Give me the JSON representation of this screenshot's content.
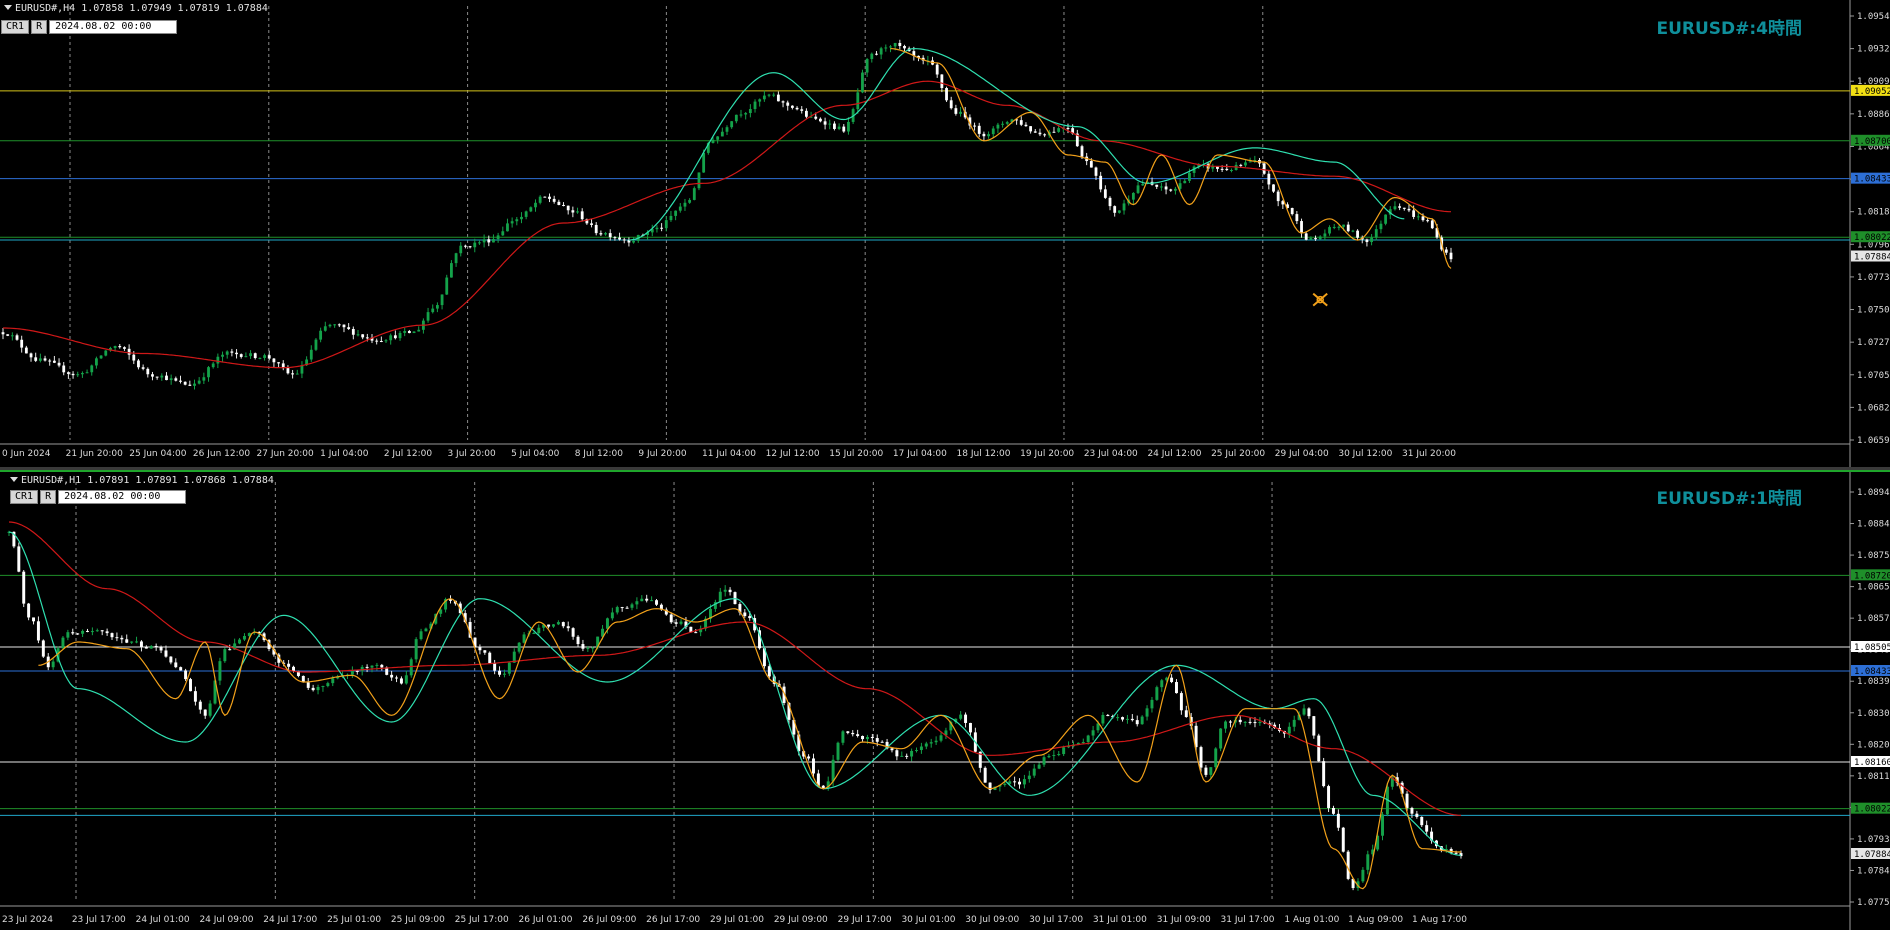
{
  "panes": [
    {
      "id": "h4",
      "info_text": "EURUSD#,H4  1.07858 1.07949 1.07819 1.07884",
      "cr_label": "CR1",
      "r_label": "R",
      "date_value": "2024.08.02 00:00",
      "tf_title": "EURUSD#:4時間",
      "price_min": 1.0659,
      "price_max": 1.0958,
      "price_ticks": [
        "1.09545",
        "1.09320",
        "1.09095",
        "1.08865",
        "1.08640",
        "1.08410",
        "1.08185",
        "1.07960",
        "1.07730",
        "1.07505",
        "1.07275",
        "1.07050",
        "1.06825",
        "1.06595"
      ],
      "time_labels": [
        "0 Jun 2024",
        "21 Jun 20:00",
        "25 Jun 04:00",
        "26 Jun 12:00",
        "27 Jun 20:00",
        "1 Jul 04:00",
        "2 Jul 12:00",
        "3 Jul 20:00",
        "5 Jul 04:00",
        "8 Jul 12:00",
        "9 Jul 20:00",
        "11 Jul 04:00",
        "12 Jul 12:00",
        "15 Jul 20:00",
        "17 Jul 04:00",
        "18 Jul 12:00",
        "19 Jul 20:00",
        "23 Jul 04:00",
        "24 Jul 12:00",
        "25 Jul 20:00",
        "29 Jul 04:00",
        "30 Jul 12:00",
        "31 Jul 20:00"
      ],
      "hlines": [
        {
          "price": 1.09052,
          "color": "#d4c21a",
          "label": "1.09052",
          "label_bg": "#f2e014",
          "label_fg": "#000000"
        },
        {
          "price": 1.087,
          "color": "#1f8f2a",
          "label": "1.08700",
          "label_bg": "#1f8f2a",
          "label_fg": "#000000"
        },
        {
          "price": 1.08433,
          "color": "#2d6fd6",
          "label": "1.08433",
          "label_bg": "#2d6fd6",
          "label_fg": "#000000"
        },
        {
          "price": 1.0802,
          "color": "#1f8f2a",
          "label": "1.08022",
          "label_bg": "#1f8f2a",
          "label_fg": "#000000"
        },
        {
          "price": 1.08,
          "color": "#20a7c9",
          "label": "",
          "label_bg": "",
          "label_fg": ""
        }
      ],
      "current_price": {
        "label": "1.07884",
        "price": 1.07884
      },
      "anchors": [
        [
          0,
          1.0735
        ],
        [
          8,
          1.0715
        ],
        [
          16,
          1.0705
        ],
        [
          24,
          1.0725
        ],
        [
          32,
          1.0705
        ],
        [
          40,
          1.0698
        ],
        [
          48,
          1.072
        ],
        [
          56,
          1.0718
        ],
        [
          62,
          1.0705
        ],
        [
          70,
          1.074
        ],
        [
          80,
          1.073
        ],
        [
          88,
          1.0735
        ],
        [
          92,
          1.0752
        ],
        [
          98,
          1.0795
        ],
        [
          104,
          1.08
        ],
        [
          110,
          1.0815
        ],
        [
          116,
          1.083
        ],
        [
          122,
          1.082
        ],
        [
          128,
          1.0805
        ],
        [
          134,
          1.08
        ],
        [
          140,
          1.0808
        ],
        [
          146,
          1.0825
        ],
        [
          152,
          1.0872
        ],
        [
          158,
          1.089
        ],
        [
          164,
          1.0902
        ],
        [
          168,
          1.0895
        ],
        [
          174,
          1.0885
        ],
        [
          180,
          1.0878
        ],
        [
          186,
          1.093
        ],
        [
          190,
          1.0938
        ],
        [
          198,
          1.0925
        ],
        [
          204,
          1.089
        ],
        [
          210,
          1.0875
        ],
        [
          216,
          1.0885
        ],
        [
          222,
          1.0875
        ],
        [
          228,
          1.088
        ],
        [
          232,
          1.0855
        ],
        [
          238,
          1.082
        ],
        [
          244,
          1.084
        ],
        [
          250,
          1.0835
        ],
        [
          256,
          1.0852
        ],
        [
          262,
          1.085
        ],
        [
          268,
          1.0855
        ],
        [
          274,
          1.0825
        ],
        [
          280,
          1.08
        ],
        [
          286,
          1.081
        ],
        [
          292,
          1.08
        ],
        [
          298,
          1.0825
        ],
        [
          304,
          1.0815
        ],
        [
          310,
          1.0788
        ]
      ],
      "ma_anchors": [
        [
          0,
          1.0738
        ],
        [
          30,
          1.072
        ],
        [
          60,
          1.071
        ],
        [
          90,
          1.074
        ],
        [
          120,
          1.0812
        ],
        [
          150,
          1.084
        ],
        [
          180,
          1.0895
        ],
        [
          198,
          1.0912
        ],
        [
          215,
          1.0895
        ],
        [
          235,
          1.087
        ],
        [
          260,
          1.0852
        ],
        [
          285,
          1.0845
        ],
        [
          310,
          1.082
        ]
      ],
      "cyan_anchors": [
        [
          134,
          1.08
        ],
        [
          165,
          1.0918
        ],
        [
          180,
          1.0885
        ],
        [
          195,
          1.0935
        ],
        [
          230,
          1.088
        ],
        [
          245,
          1.084
        ],
        [
          268,
          1.0865
        ],
        [
          285,
          1.0855
        ],
        [
          300,
          1.0815
        ]
      ],
      "orange_anchors": [
        [
          190,
          1.0935
        ],
        [
          200,
          1.0925
        ],
        [
          210,
          1.087
        ],
        [
          220,
          1.089
        ],
        [
          228,
          1.086
        ],
        [
          236,
          1.0855
        ],
        [
          242,
          1.0825
        ],
        [
          248,
          1.086
        ],
        [
          254,
          1.0825
        ],
        [
          260,
          1.086
        ],
        [
          270,
          1.0855
        ],
        [
          278,
          1.0805
        ],
        [
          284,
          1.0815
        ],
        [
          290,
          1.08
        ],
        [
          298,
          1.083
        ],
        [
          306,
          1.0815
        ],
        [
          310,
          1.078
        ]
      ],
      "cross_marker": {
        "price": 1.0758,
        "x_index": 282
      }
    },
    {
      "id": "h1",
      "info_text": "EURUSD#,H1  1.07891 1.07891 1.07868 1.07884",
      "cr_label": "CR1",
      "r_label": "R",
      "date_value": "2024.08.02 00:00",
      "tf_title": "EURUSD#:1時間",
      "price_min": 1.0774,
      "price_max": 1.0897,
      "price_ticks": [
        "1.08940",
        "1.08845",
        "1.08750",
        "1.08655",
        "1.08570",
        "1.08480",
        "1.08390",
        "1.08300",
        "1.08205",
        "1.08115",
        "1.08025",
        "1.07930",
        "1.07840",
        "1.07750"
      ],
      "time_labels": [
        "23 Jul 2024",
        "23 Jul 17:00",
        "24 Jul 01:00",
        "24 Jul 09:00",
        "24 Jul 17:00",
        "25 Jul 01:00",
        "25 Jul 09:00",
        "25 Jul 17:00",
        "26 Jul 01:00",
        "26 Jul 09:00",
        "26 Jul 17:00",
        "29 Jul 01:00",
        "29 Jul 09:00",
        "29 Jul 17:00",
        "30 Jul 01:00",
        "30 Jul 09:00",
        "30 Jul 17:00",
        "31 Jul 01:00",
        "31 Jul 09:00",
        "31 Jul 17:00",
        "1 Aug 01:00",
        "1 Aug 09:00",
        "1 Aug 17:00"
      ],
      "hlines": [
        {
          "price": 1.0872,
          "color": "#1f8f2a",
          "label": "1.08720",
          "label_bg": "#1f8f2a",
          "label_fg": "#000000"
        },
        {
          "price": 1.08505,
          "color": "#e6e6e6",
          "label": "1.08505",
          "label_bg": "#ffffff",
          "label_fg": "#000000"
        },
        {
          "price": 1.08433,
          "color": "#2d6fd6",
          "label": "1.08433",
          "label_bg": "#2d6fd6",
          "label_fg": "#000000"
        },
        {
          "price": 1.0816,
          "color": "#e6e6e6",
          "label": "1.08160",
          "label_bg": "#ffffff",
          "label_fg": "#000000"
        },
        {
          "price": 1.0802,
          "color": "#1f8f2a",
          "label": "1.08022",
          "label_bg": "#1f8f2a",
          "label_fg": "#000000"
        },
        {
          "price": 1.08,
          "color": "#20a7c9",
          "label": "",
          "label_bg": "",
          "label_fg": ""
        }
      ],
      "current_price": {
        "label": "1.07884",
        "price": 1.07884
      },
      "anchors": [
        [
          0,
          1.0885
        ],
        [
          4,
          1.086
        ],
        [
          8,
          1.0845
        ],
        [
          12,
          1.0855
        ],
        [
          18,
          1.0855
        ],
        [
          24,
          1.0852
        ],
        [
          30,
          1.085
        ],
        [
          34,
          1.0845
        ],
        [
          40,
          1.083
        ],
        [
          44,
          1.085
        ],
        [
          50,
          1.0855
        ],
        [
          56,
          1.0845
        ],
        [
          62,
          1.0838
        ],
        [
          68,
          1.0842
        ],
        [
          74,
          1.0845
        ],
        [
          80,
          1.084
        ],
        [
          84,
          1.0855
        ],
        [
          90,
          1.0865
        ],
        [
          96,
          1.085
        ],
        [
          100,
          1.0842
        ],
        [
          106,
          1.0855
        ],
        [
          112,
          1.0858
        ],
        [
          118,
          1.085
        ],
        [
          124,
          1.0862
        ],
        [
          130,
          1.0865
        ],
        [
          136,
          1.0858
        ],
        [
          140,
          1.0855
        ],
        [
          146,
          1.0868
        ],
        [
          150,
          1.086
        ],
        [
          156,
          1.084
        ],
        [
          162,
          1.0818
        ],
        [
          166,
          1.0808
        ],
        [
          170,
          1.0825
        ],
        [
          176,
          1.0823
        ],
        [
          182,
          1.0818
        ],
        [
          188,
          1.0822
        ],
        [
          194,
          1.083
        ],
        [
          200,
          1.0808
        ],
        [
          206,
          1.081
        ],
        [
          212,
          1.0818
        ],
        [
          218,
          1.0822
        ],
        [
          224,
          1.083
        ],
        [
          230,
          1.0828
        ],
        [
          236,
          1.0842
        ],
        [
          240,
          1.083
        ],
        [
          244,
          1.0812
        ],
        [
          248,
          1.0828
        ],
        [
          254,
          1.0828
        ],
        [
          260,
          1.0825
        ],
        [
          264,
          1.0832
        ],
        [
          270,
          1.08
        ],
        [
          274,
          1.0778
        ],
        [
          278,
          1.079
        ],
        [
          282,
          1.0812
        ],
        [
          286,
          1.08
        ],
        [
          292,
          1.079
        ],
        [
          296,
          1.0788
        ]
      ],
      "ma_anchors": [
        [
          0,
          1.0888
        ],
        [
          20,
          1.0868
        ],
        [
          40,
          1.0852
        ],
        [
          60,
          1.0843
        ],
        [
          90,
          1.0845
        ],
        [
          120,
          1.0848
        ],
        [
          150,
          1.0858
        ],
        [
          175,
          1.0838
        ],
        [
          200,
          1.0818
        ],
        [
          225,
          1.0822
        ],
        [
          250,
          1.083
        ],
        [
          270,
          1.082
        ],
        [
          296,
          1.08
        ]
      ],
      "cyan_anchors": [
        [
          0,
          1.0885
        ],
        [
          14,
          1.0838
        ],
        [
          36,
          1.0822
        ],
        [
          56,
          1.086
        ],
        [
          78,
          1.0828
        ],
        [
          96,
          1.0865
        ],
        [
          122,
          1.084
        ],
        [
          148,
          1.0865
        ],
        [
          166,
          1.0808
        ],
        [
          190,
          1.083
        ],
        [
          208,
          1.0806
        ],
        [
          238,
          1.0845
        ],
        [
          258,
          1.0832
        ],
        [
          266,
          1.0835
        ],
        [
          278,
          1.0806
        ],
        [
          296,
          1.0788
        ]
      ],
      "orange_anchors": [
        [
          6,
          1.0845
        ],
        [
          14,
          1.0852
        ],
        [
          24,
          1.085
        ],
        [
          34,
          1.0835
        ],
        [
          40,
          1.0852
        ],
        [
          44,
          1.083
        ],
        [
          50,
          1.0855
        ],
        [
          60,
          1.084
        ],
        [
          70,
          1.0842
        ],
        [
          78,
          1.083
        ],
        [
          90,
          1.0865
        ],
        [
          100,
          1.0835
        ],
        [
          108,
          1.0858
        ],
        [
          116,
          1.0843
        ],
        [
          124,
          1.0858
        ],
        [
          132,
          1.0862
        ],
        [
          140,
          1.0858
        ],
        [
          148,
          1.0862
        ],
        [
          156,
          1.084
        ],
        [
          166,
          1.0808
        ],
        [
          174,
          1.0822
        ],
        [
          182,
          1.082
        ],
        [
          190,
          1.083
        ],
        [
          200,
          1.0808
        ],
        [
          210,
          1.0818
        ],
        [
          220,
          1.083
        ],
        [
          230,
          1.081
        ],
        [
          238,
          1.0845
        ],
        [
          244,
          1.081
        ],
        [
          252,
          1.0832
        ],
        [
          262,
          1.0832
        ],
        [
          270,
          1.079
        ],
        [
          276,
          1.0778
        ],
        [
          282,
          1.0812
        ],
        [
          288,
          1.079
        ],
        [
          296,
          1.0789
        ]
      ]
    }
  ]
}
